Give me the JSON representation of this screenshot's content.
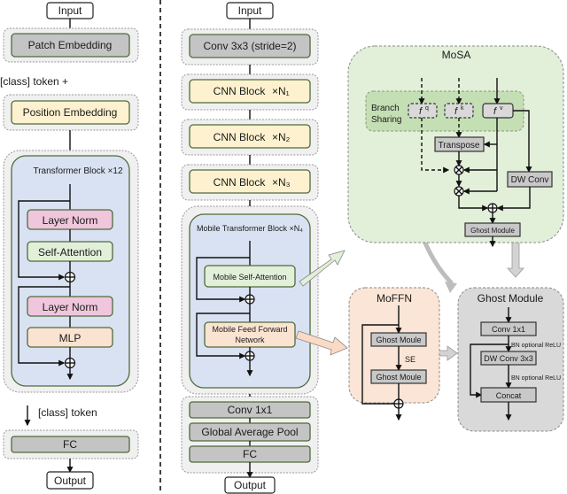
{
  "vit": {
    "input": "Input",
    "patch_embedding": "Patch Embedding",
    "class_token_plus": "[class] token +",
    "position_embedding": "Position Embedding",
    "transformer_block": "Transformer Block ×12",
    "layer_norm_1": "Layer Norm",
    "self_attention": "Self-Attention",
    "layer_norm_2": "Layer Norm",
    "mlp": "MLP",
    "class_token": "[class] token",
    "fc": "FC",
    "output": "Output"
  },
  "mobile": {
    "input": "Input",
    "conv3x3": "Conv 3x3 (stride=2)",
    "cnn_block": "CNN Block",
    "cnn_mult": [
      "×N₁",
      "×N₂",
      "×N₃"
    ],
    "mobile_transformer_block": "Mobile Transformer Block ×N₄",
    "mobile_self_attention": "Mobile Self-Attention",
    "mobile_ffn_line1": "Mobile Feed Forward",
    "mobile_ffn_line2": "Network",
    "conv1x1": "Conv 1x1",
    "global_average_pool": "Global Average Pool",
    "fc": "FC",
    "output": "Output"
  },
  "mosa": {
    "title": "MoSA",
    "branch_line1": "Branch",
    "branch_line2": "Sharing",
    "fq": "f",
    "fq_sup": "q",
    "fk": "f",
    "fk_sup": "k",
    "fv": "f",
    "fv_sup": "v",
    "transpose": "Transpose",
    "dw_conv": "DW Conv",
    "ghost_module": "Ghost Module"
  },
  "moffn": {
    "title": "MoFFN",
    "ghost_1": "Ghost Moule",
    "se": "SE",
    "ghost_2": "Ghost Moule"
  },
  "ghost": {
    "title": "Ghost Module",
    "conv1x1": "Conv 1x1",
    "bn1": "BN optional ReLU",
    "dwconv": "DW Conv 3x3",
    "bn2": "BN optional ReLU",
    "concat": "Concat"
  },
  "colors": {
    "gray_block": "#c4c4c4",
    "yellow_block": "#fdf1cf",
    "blue_block": "#d9e2f2",
    "pink_block": "#efc6dc",
    "green_block": "#e2efd9",
    "peach_block": "#fbe3d2"
  }
}
